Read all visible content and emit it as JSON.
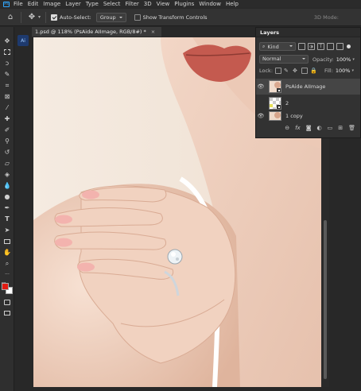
{
  "menu": {
    "items": [
      "File",
      "Edit",
      "Image",
      "Layer",
      "Type",
      "Select",
      "Filter",
      "3D",
      "View",
      "Plugins",
      "Window",
      "Help"
    ]
  },
  "options": {
    "auto_select_label": "Auto-Select:",
    "auto_select_value": "Group",
    "transform_label": "Show Transform Controls",
    "mode_3d": "3D Mode:"
  },
  "document": {
    "tab_title": "1.psd @ 118% (PsAide AIImage, RGB/8#) *",
    "close": "×"
  },
  "sidebar": {
    "plugin_label": "Ai"
  },
  "layers_panel": {
    "title": "Layers",
    "filter_kind": "Kind",
    "blend_mode": "Normal",
    "opacity_label": "Opacity:",
    "opacity_value": "100%",
    "lock_label": "Lock:",
    "fill_label": "Fill:",
    "fill_value": "100%",
    "layers": [
      {
        "name": "PsAide AIImage",
        "selected": true
      },
      {
        "name": "2",
        "selected": false
      },
      {
        "name": "1 copy",
        "selected": false
      }
    ],
    "footer_icons": [
      "link-icon",
      "fx-icon",
      "mask-icon",
      "adjustment-icon",
      "group-icon",
      "new-layer-icon",
      "trash-icon"
    ],
    "footer_fx": "fx"
  },
  "colors": {
    "foreground": "#e11b12",
    "background": "#ffffff",
    "accent": "#31a8ff"
  }
}
